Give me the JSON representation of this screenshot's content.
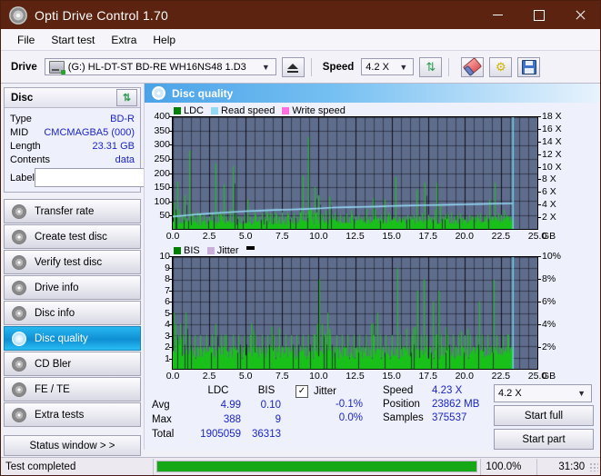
{
  "window": {
    "title": "Opti Drive Control 1.70",
    "icon": "disc-icon",
    "minimize": "—",
    "maximize": "□",
    "close": "✕"
  },
  "menu": {
    "items": [
      "File",
      "Start test",
      "Extra",
      "Help"
    ]
  },
  "toolbar": {
    "drive_label": "Drive",
    "drive_value": "(G:)  HL-DT-ST BD-RE  WH16NS48 1.D3",
    "eject_title": "eject-button",
    "speed_label": "Speed",
    "speed_value": "4.2 X",
    "refresh_icon": "⇅",
    "erase_icon": "eraser-icon",
    "tools_icon": "⚙",
    "save_icon": "floppy-icon"
  },
  "disc": {
    "group_title": "Disc",
    "refresh_icon": "⇅",
    "rows": [
      {
        "key": "Type",
        "value": "BD-R"
      },
      {
        "key": "MID",
        "value": "CMCMAGBA5 (000)"
      },
      {
        "key": "Length",
        "value": "23.31 GB"
      },
      {
        "key": "Contents",
        "value": "data"
      }
    ],
    "label_key": "Label",
    "label_value": "",
    "label_placeholder": ""
  },
  "nav": {
    "items": [
      {
        "label": "Transfer rate",
        "active": false
      },
      {
        "label": "Create test disc",
        "active": false
      },
      {
        "label": "Verify test disc",
        "active": false
      },
      {
        "label": "Drive info",
        "active": false
      },
      {
        "label": "Disc info",
        "active": false
      },
      {
        "label": "Disc quality",
        "active": true
      },
      {
        "label": "CD Bler",
        "active": false
      },
      {
        "label": "FE / TE",
        "active": false
      },
      {
        "label": "Extra tests",
        "active": false
      }
    ],
    "status_window": "Status window > >"
  },
  "panel": {
    "title": "Disc quality",
    "icon": "disc-quality-icon"
  },
  "colors": {
    "ldc": "#19c019",
    "read_speed": "#93d8f5",
    "write_speed": "#ff6fe0",
    "bis": "#19c019",
    "jitter": "#c9b0d8",
    "plot_bg": "#5f6d8d",
    "accent": "#1a25c8",
    "title_bar": "#5b2310",
    "progress": "#16a816"
  },
  "chart_data": [
    {
      "type": "line",
      "title": "LDC / Read speed",
      "legend": [
        {
          "label": "LDC",
          "color": "#008000"
        },
        {
          "label": "Read speed",
          "color": "#93d8f5"
        },
        {
          "label": "Write speed",
          "color": "#ff6fe0"
        }
      ],
      "legend_position": "top-left",
      "xlabel": "GB",
      "xlim": [
        0,
        25
      ],
      "xticks": [
        "0.0",
        "2.5",
        "5.0",
        "7.5",
        "10.0",
        "12.5",
        "15.0",
        "17.5",
        "20.0",
        "22.5",
        "25.0"
      ],
      "ylabel": "",
      "ylim": [
        0,
        400
      ],
      "yticks": [
        400,
        350,
        300,
        250,
        200,
        150,
        100,
        50
      ],
      "y2label": "X",
      "y2lim": [
        0,
        18
      ],
      "y2ticks": [
        "18 X",
        "16 X",
        "14 X",
        "12 X",
        "10 X",
        "8 X",
        "6 X",
        "4 X",
        "2 X"
      ],
      "grid": true,
      "data_end_gb": 23.3,
      "series": [
        {
          "name": "LDC",
          "color": "#19c019",
          "type": "spikes",
          "x": [
            0.05,
            0.15,
            0.3,
            0.45,
            0.6,
            0.8,
            0.95,
            1.1,
            1.3,
            1.5,
            1.7,
            1.9,
            2.1,
            2.3,
            2.5,
            2.7,
            2.9,
            3.1,
            3.3,
            3.5,
            3.7,
            3.9,
            4.1,
            4.3,
            4.5,
            4.7,
            4.9,
            5.1,
            5.3,
            5.5,
            5.7,
            5.9,
            6.1,
            6.3,
            6.5,
            6.7,
            6.9,
            7.1,
            7.3,
            7.5,
            7.7,
            7.9,
            8.1,
            8.3,
            8.5,
            8.7,
            8.9,
            9.1,
            9.3,
            9.5,
            9.7,
            9.85,
            10.0,
            10.15,
            10.3,
            10.5,
            10.7,
            10.9,
            11.1,
            11.3,
            11.5,
            11.7,
            11.9,
            12.1,
            12.3,
            12.5,
            12.7,
            12.9,
            13.1,
            13.3,
            13.5,
            13.7,
            13.9,
            14.1,
            14.3,
            14.5,
            14.7,
            14.9,
            15.1,
            15.3,
            15.5,
            15.7,
            15.9,
            16.1,
            16.3,
            16.5,
            16.7,
            16.9,
            17.1,
            17.3,
            17.5,
            17.7,
            17.9,
            18.1,
            18.3,
            18.5,
            18.7,
            18.9,
            19.1,
            19.3,
            19.5,
            19.7,
            19.9,
            20.1,
            20.3,
            20.5,
            20.7,
            20.9,
            21.1,
            21.3,
            21.5,
            21.7,
            21.9,
            22.1,
            22.3,
            22.5,
            22.7,
            22.9,
            23.1,
            23.25
          ],
          "values": [
            95,
            60,
            170,
            70,
            45,
            120,
            40,
            280,
            55,
            40,
            60,
            45,
            50,
            40,
            45,
            60,
            235,
            55,
            50,
            160,
            45,
            70,
            225,
            50,
            45,
            40,
            50,
            105,
            45,
            40,
            50,
            45,
            55,
            40,
            45,
            55,
            40,
            50,
            45,
            60,
            45,
            50,
            40,
            55,
            45,
            60,
            190,
            55,
            330,
            70,
            150,
            60,
            120,
            55,
            50,
            45,
            115,
            50,
            60,
            45,
            50,
            45,
            55,
            40,
            50,
            45,
            50,
            40,
            45,
            50,
            45,
            110,
            45,
            40,
            50,
            105,
            45,
            50,
            40,
            185,
            45,
            40,
            45,
            50,
            45,
            50,
            140,
            45,
            55,
            165,
            50,
            45,
            40,
            165,
            50,
            45,
            55,
            50,
            60,
            45,
            50,
            55,
            40,
            45,
            50,
            45,
            40,
            50,
            55,
            45,
            50,
            105,
            45,
            165,
            55,
            50,
            40,
            50,
            45,
            40
          ]
        },
        {
          "name": "Read speed",
          "color": "#93d8f5",
          "type": "line",
          "x": [
            0.0,
            1.0,
            2.0,
            3.0,
            4.0,
            5.0,
            6.0,
            7.0,
            8.0,
            9.0,
            10.0,
            11.0,
            12.0,
            13.0,
            14.0,
            15.0,
            16.0,
            17.0,
            18.0,
            19.0,
            20.0,
            21.0,
            22.0,
            23.0,
            23.3
          ],
          "values": [
            2.0,
            2.2,
            2.4,
            2.55,
            2.7,
            2.85,
            2.95,
            3.05,
            3.1,
            3.2,
            3.3,
            3.45,
            3.5,
            3.55,
            3.6,
            3.7,
            3.75,
            3.8,
            3.85,
            3.9,
            3.95,
            4.0,
            4.05,
            4.1,
            4.1
          ]
        }
      ]
    },
    {
      "type": "line",
      "title": "BIS / Jitter",
      "legend": [
        {
          "label": "BIS",
          "color": "#008000"
        },
        {
          "label": "Jitter",
          "color": "#c9b0d8"
        }
      ],
      "legend_position": "top-left",
      "xlabel": "GB",
      "xlim": [
        0,
        25
      ],
      "xticks": [
        "0.0",
        "2.5",
        "5.0",
        "7.5",
        "10.0",
        "12.5",
        "15.0",
        "17.5",
        "20.0",
        "22.5",
        "25.0"
      ],
      "ylim": [
        0,
        10
      ],
      "yticks": [
        10,
        9,
        8,
        7,
        6,
        5,
        4,
        3,
        2,
        1
      ],
      "y2ticks": [
        "10%",
        "8%",
        "6%",
        "4%",
        "2%"
      ],
      "y2lim": [
        0,
        10
      ],
      "grid": true,
      "data_end_gb": 23.3,
      "series": [
        {
          "name": "BIS",
          "color": "#19c019",
          "type": "spikes",
          "x": [
            0.05,
            0.2,
            0.35,
            0.5,
            0.7,
            0.9,
            1.1,
            1.3,
            1.5,
            1.7,
            1.9,
            2.1,
            2.3,
            2.5,
            2.7,
            2.9,
            3.1,
            3.3,
            3.5,
            3.7,
            3.9,
            4.1,
            4.3,
            4.5,
            4.7,
            4.9,
            5.1,
            5.3,
            5.5,
            5.7,
            5.9,
            6.1,
            6.3,
            6.5,
            6.7,
            6.9,
            7.1,
            7.3,
            7.5,
            7.7,
            7.9,
            8.1,
            8.3,
            8.5,
            8.7,
            8.9,
            9.1,
            9.3,
            9.5,
            9.7,
            9.9,
            10.05,
            10.2,
            10.4,
            10.6,
            10.8,
            11.0,
            11.2,
            11.4,
            11.6,
            11.8,
            12.0,
            12.2,
            12.4,
            12.6,
            12.8,
            13.0,
            13.2,
            13.4,
            13.6,
            13.8,
            14.0,
            14.2,
            14.4,
            14.6,
            14.8,
            15.0,
            15.2,
            15.4,
            15.6,
            15.8,
            16.0,
            16.2,
            16.4,
            16.6,
            16.8,
            17.0,
            17.2,
            17.4,
            17.6,
            17.8,
            18.0,
            18.2,
            18.4,
            18.6,
            18.8,
            19.0,
            19.2,
            19.4,
            19.6,
            19.8,
            20.0,
            20.2,
            20.4,
            20.6,
            20.8,
            21.0,
            21.2,
            21.4,
            21.6,
            21.8,
            22.0,
            22.2,
            22.4,
            22.6,
            22.8,
            23.0,
            23.2
          ],
          "values": [
            5,
            4,
            3,
            4,
            3,
            5,
            3,
            2,
            3,
            2,
            3,
            2,
            3,
            2,
            3,
            4,
            2,
            3,
            2,
            3,
            2,
            3,
            2,
            3,
            2,
            3,
            2,
            3,
            2,
            3,
            2,
            3,
            2,
            3,
            2,
            3,
            2,
            3,
            2,
            3,
            2,
            3,
            2,
            3,
            2,
            3,
            2,
            3,
            2,
            3,
            4,
            8,
            4,
            3,
            5,
            3,
            2,
            3,
            2,
            3,
            2,
            3,
            2,
            3,
            2,
            3,
            2,
            3,
            2,
            4,
            3,
            5,
            3,
            2,
            3,
            2,
            3,
            2,
            9,
            3,
            2,
            3,
            2,
            3,
            2,
            7,
            3,
            8,
            3,
            2,
            6,
            3,
            7,
            3,
            2,
            3,
            2,
            3,
            2,
            3,
            2,
            3,
            2,
            3,
            2,
            3,
            6,
            3,
            2,
            3,
            2,
            8,
            3,
            2,
            3,
            2,
            3,
            2
          ]
        }
      ]
    }
  ],
  "stats": {
    "headers": [
      "",
      "LDC",
      "BIS"
    ],
    "rows": [
      {
        "label": "Avg",
        "ldc": "4.99",
        "bis": "0.10"
      },
      {
        "label": "Max",
        "ldc": "388",
        "bis": "9"
      },
      {
        "label": "Total",
        "ldc": "1905059",
        "bis": "36313"
      }
    ],
    "jitter": {
      "checkbox_label": "Jitter",
      "checked": true,
      "check_glyph": "✓",
      "values": [
        "-0.1%",
        "0.0%"
      ]
    },
    "info": [
      {
        "key": "Speed",
        "value": "4.23 X"
      },
      {
        "key": "Position",
        "value": "23862 MB"
      },
      {
        "key": "Samples",
        "value": "375537"
      }
    ],
    "speed_select": "4.2 X",
    "start_full": "Start full",
    "start_part": "Start part"
  },
  "statusbar": {
    "message": "Test completed",
    "progress_percent": 100.0,
    "progress_text": "100.0%",
    "elapsed": "31:30"
  }
}
